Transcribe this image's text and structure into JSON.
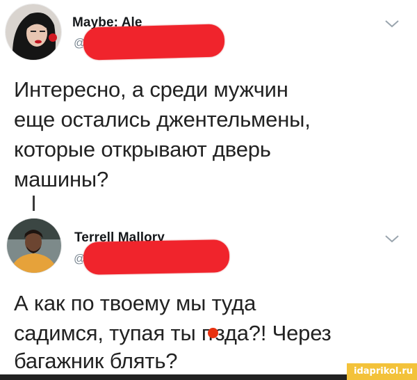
{
  "tweet1": {
    "name": "Maybe: Ale",
    "handle": "@",
    "lines": [
      "Интересно, а среди мужчин",
      "еще остались джентельмены,",
      "которые открывают дверь",
      "машины?"
    ]
  },
  "tweet2": {
    "name": "Terrell Mallory",
    "handle": "@",
    "line1": "А как по твоему мы туда",
    "line2_before": "садимся, тупая ты п",
    "line2_after": "зда?! Через",
    "line3": "багажник блять?"
  },
  "watermark": "idaprikol.ru",
  "colors": {
    "redaction": "#f0242c",
    "censor": "#e8310f",
    "watermark_bg": "#f3c23a"
  }
}
